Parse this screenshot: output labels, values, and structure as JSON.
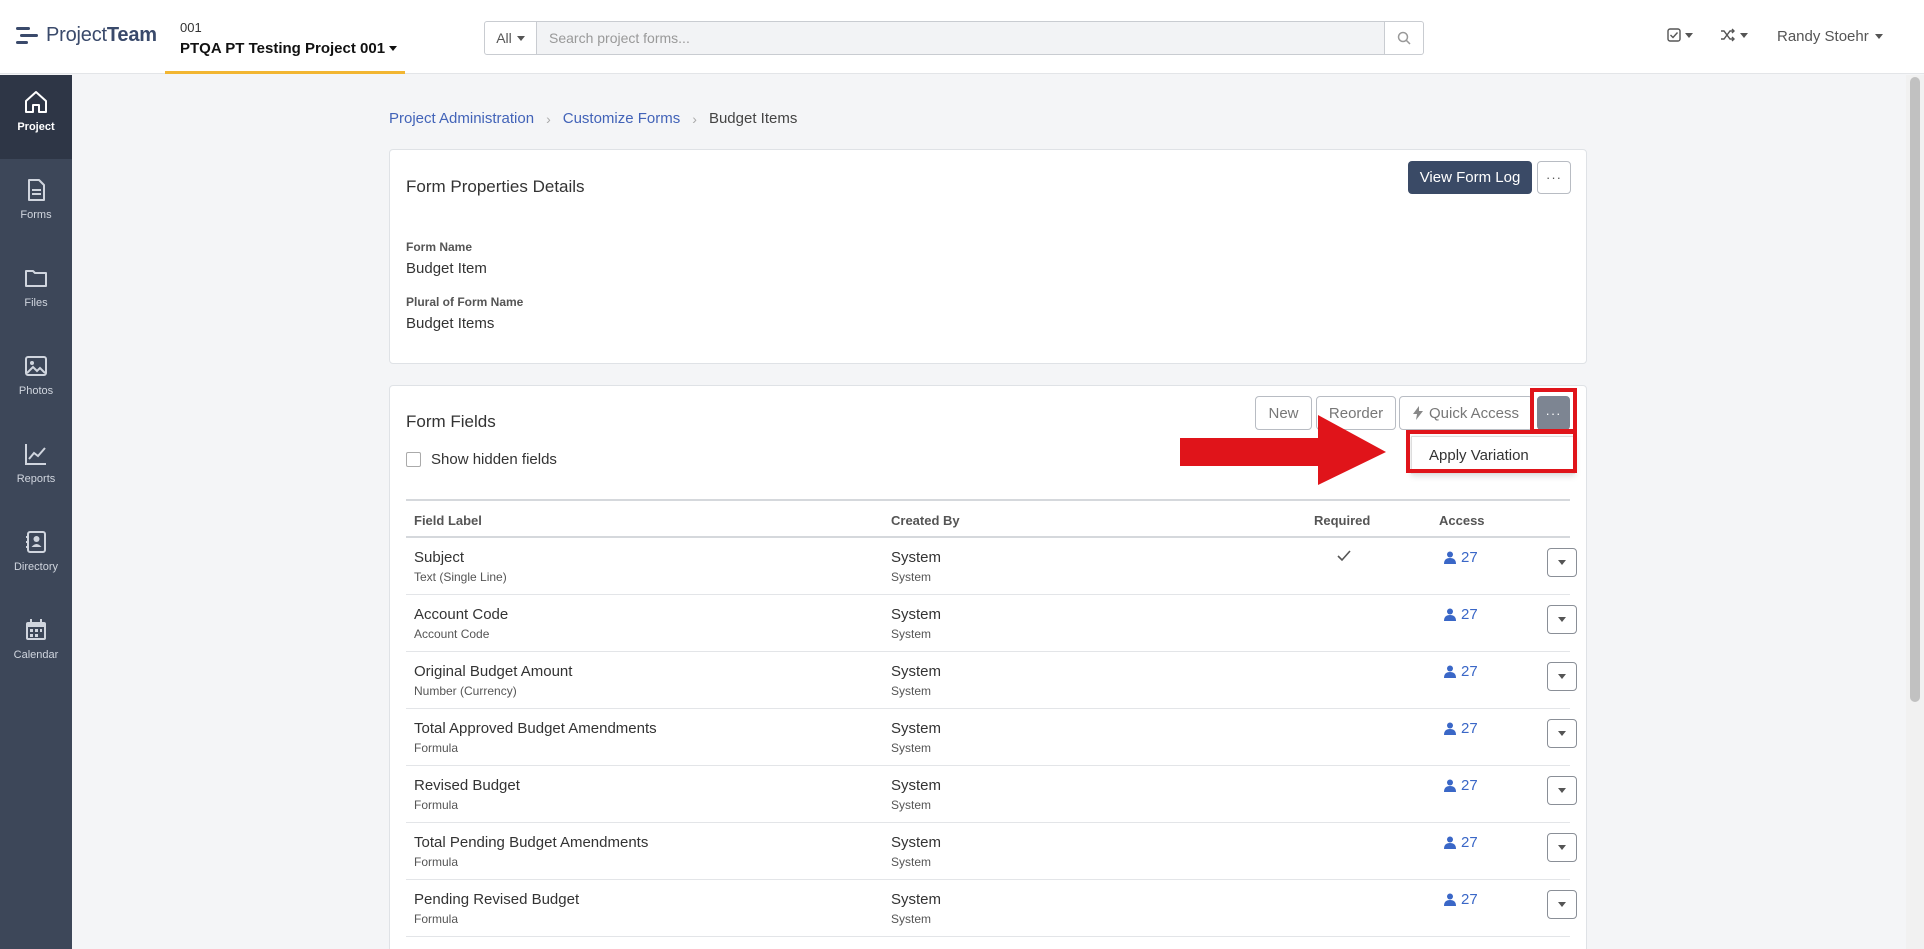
{
  "header": {
    "logo_text_light": "Project",
    "logo_text_bold": "Team",
    "project_number": "001",
    "project_name": "PTQA PT Testing Project 001",
    "search_scope": "All",
    "search_placeholder": "Search project forms...",
    "user_name": "Randy Stoehr"
  },
  "sidebar": {
    "items": [
      {
        "label": "Project",
        "icon": "home-icon",
        "active": true
      },
      {
        "label": "Forms",
        "icon": "document-icon"
      },
      {
        "label": "Files",
        "icon": "folder-icon"
      },
      {
        "label": "Photos",
        "icon": "image-icon"
      },
      {
        "label": "Reports",
        "icon": "chart-line-icon"
      },
      {
        "label": "Directory",
        "icon": "contact-book-icon"
      },
      {
        "label": "Calendar",
        "icon": "calendar-icon"
      }
    ]
  },
  "breadcrumb": {
    "items": [
      "Project Administration",
      "Customize Forms"
    ],
    "current": "Budget Items"
  },
  "properties": {
    "title": "Form Properties Details",
    "view_log_label": "View Form Log",
    "more_label": "···",
    "form_name_label": "Form Name",
    "form_name_value": "Budget Item",
    "plural_label": "Plural of Form Name",
    "plural_value": "Budget Items"
  },
  "fields": {
    "title": "Form Fields",
    "show_hidden_label": "Show hidden fields",
    "new_label": "New",
    "reorder_label": "Reorder",
    "quick_access_label": "Quick Access",
    "more_label": "···",
    "dropdown_item": "Apply Variation",
    "columns": {
      "label": "Field Label",
      "created_by": "Created By",
      "required": "Required",
      "access": "Access"
    },
    "rows": [
      {
        "label": "Subject",
        "type": "Text (Single Line)",
        "created": "System",
        "created_sub": "System",
        "required": true,
        "access": "27"
      },
      {
        "label": "Account Code",
        "type": "Account Code",
        "created": "System",
        "created_sub": "System",
        "required": false,
        "access": "27"
      },
      {
        "label": "Original Budget Amount",
        "type": "Number (Currency)",
        "created": "System",
        "created_sub": "System",
        "required": false,
        "access": "27"
      },
      {
        "label": "Total Approved Budget Amendments",
        "type": "Formula",
        "created": "System",
        "created_sub": "System",
        "required": false,
        "access": "27"
      },
      {
        "label": "Revised Budget",
        "type": "Formula",
        "created": "System",
        "created_sub": "System",
        "required": false,
        "access": "27"
      },
      {
        "label": "Total Pending Budget Amendments",
        "type": "Formula",
        "created": "System",
        "created_sub": "System",
        "required": false,
        "access": "27"
      },
      {
        "label": "Pending Revised Budget",
        "type": "Formula",
        "created": "System",
        "created_sub": "System",
        "required": false,
        "access": "27"
      }
    ]
  },
  "colors": {
    "sidebar": "#3d4759",
    "accent": "#f2b632",
    "link": "#4263b8",
    "primary_button": "#3a4a66",
    "annotation": "#e0141a"
  }
}
